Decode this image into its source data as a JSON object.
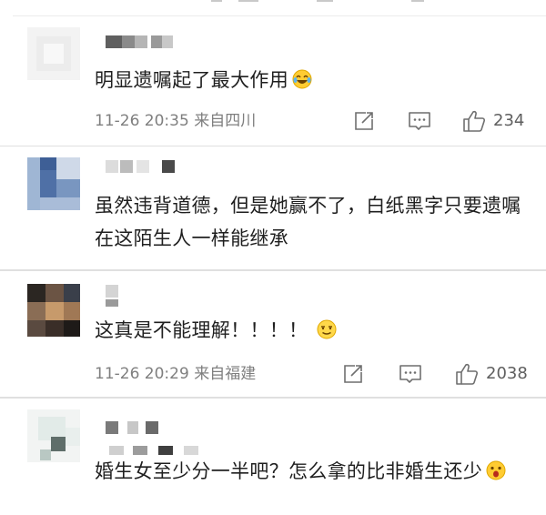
{
  "comments": [
    {
      "text": "明显遗嘱起了最大作用",
      "emoji": "laughing-tears-emoji",
      "timestamp": "11-26 20:35",
      "location": "来自四川",
      "likes": "234"
    },
    {
      "text": "虽然违背道德，但是她赢不了，白纸黑字只要遗嘱在这陌生人一样能继承"
    },
    {
      "text": "这真是不能理解！！！！",
      "emoji": "awkward-smile-emoji",
      "timestamp": "11-26 20:29",
      "location": "来自福建",
      "likes": "2038"
    },
    {
      "text": "婚生女至少分一半吧？怎么拿的比非婚生还少",
      "emoji": "shocked-emoji"
    }
  ],
  "icons": {
    "share": "share-icon",
    "comment": "comment-icon",
    "like": "thumbs-up-icon"
  },
  "colors": {
    "text": "#1f1f1f",
    "meta": "#7f7f7f",
    "icon": "#6f6f6f",
    "divider": "#e0e0e0",
    "background": "#ffffff"
  }
}
